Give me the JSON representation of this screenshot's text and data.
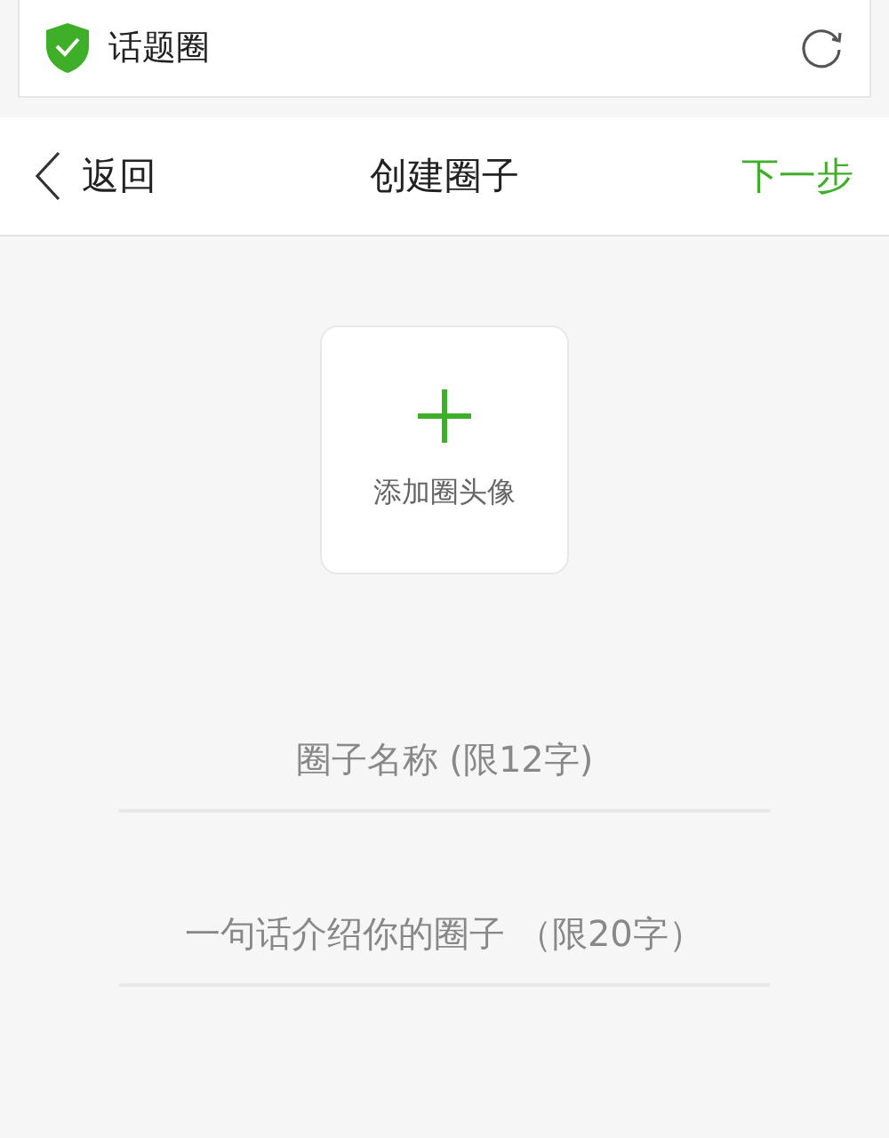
{
  "browser_bar": {
    "title": "话题圈"
  },
  "nav": {
    "back": "返回",
    "title": "创建圈子",
    "next": "下一步"
  },
  "avatar_upload": {
    "label": "添加圈头像"
  },
  "fields": [
    {
      "placeholder": "圈子名称 (限12字)"
    },
    {
      "placeholder": "一句话介绍你的圈子 （限20字）"
    }
  ]
}
